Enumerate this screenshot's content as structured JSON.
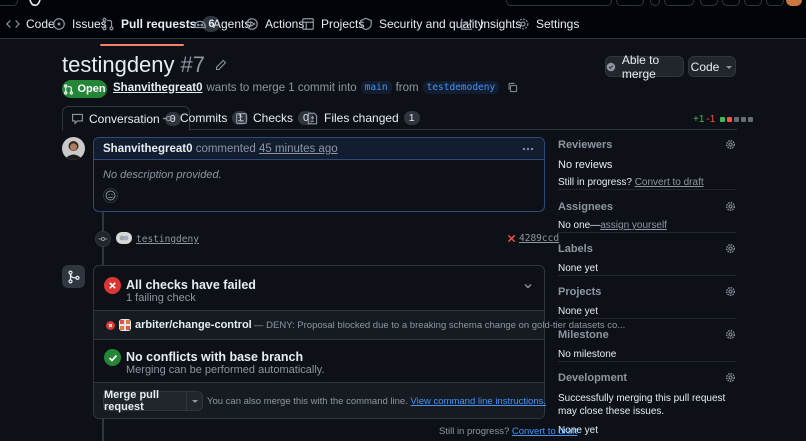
{
  "nav": {
    "items": [
      {
        "label": "Code",
        "icon": "code-icon"
      },
      {
        "label": "Issues",
        "icon": "issue-icon"
      },
      {
        "label": "Pull requests",
        "icon": "pull-request-icon",
        "count": "6"
      },
      {
        "label": "Agents",
        "icon": "agents-icon"
      },
      {
        "label": "Actions",
        "icon": "play-icon"
      },
      {
        "label": "Projects",
        "icon": "table-icon"
      },
      {
        "label": "Security and quality",
        "icon": "shield-icon"
      },
      {
        "label": "Insights",
        "icon": "graph-icon"
      },
      {
        "label": "Settings",
        "icon": "gear-icon"
      }
    ]
  },
  "pr": {
    "title": "testingdeny",
    "number": "#7",
    "state": "Open",
    "author": "Shanvithegreat0",
    "meta_text_1": "wants to merge 1 commit into",
    "base_branch": "main",
    "meta_text_2": "from",
    "head_branch": "testdemodeny",
    "able_to_merge": "Able to merge",
    "code_button": "Code"
  },
  "tabs": [
    {
      "label": "Conversation",
      "count": "0"
    },
    {
      "label": "Commits",
      "count": "1"
    },
    {
      "label": "Checks",
      "count": "0"
    },
    {
      "label": "Files changed",
      "count": "1"
    }
  ],
  "diffstat": {
    "added": "+1",
    "removed": "-1"
  },
  "comment": {
    "author": "Shanvithegreat0",
    "action": "commented",
    "time": "45 minutes ago",
    "body": "No description provided."
  },
  "commit": {
    "message": "testingdeny",
    "sha": "4289ccd"
  },
  "checks": {
    "title": "All checks have failed",
    "subtitle": "1 failing check",
    "check_name": "arbiter/change-control",
    "check_desc": "— DENY: Proposal blocked due to a breaking schema change on gold-tier datasets co..."
  },
  "conflicts": {
    "title": "No conflicts with base branch",
    "subtitle": "Merging can be performed automatically."
  },
  "merge": {
    "button": "Merge pull request",
    "hint": "You can also merge this with the command line.",
    "link": "View command line instructions."
  },
  "footer": {
    "text": "Still in progress?",
    "link": "Convert to draft"
  },
  "sidebar": {
    "reviewers": {
      "title": "Reviewers",
      "value": "No reviews",
      "extra": "Still in progress?",
      "extra_link": "Convert to draft"
    },
    "assignees": {
      "title": "Assignees",
      "value": "No one—",
      "link": "assign yourself"
    },
    "labels": {
      "title": "Labels",
      "value": "None yet"
    },
    "projects": {
      "title": "Projects",
      "value": "None yet"
    },
    "milestone": {
      "title": "Milestone",
      "value": "No milestone"
    },
    "development": {
      "title": "Development",
      "value": "Successfully merging this pull request may close these issues.",
      "extra": "None yet"
    }
  },
  "colors": {
    "accent": "#4493f8",
    "open": "#238636",
    "danger": "#da3633",
    "success": "#238636",
    "underline": "#f78166"
  }
}
